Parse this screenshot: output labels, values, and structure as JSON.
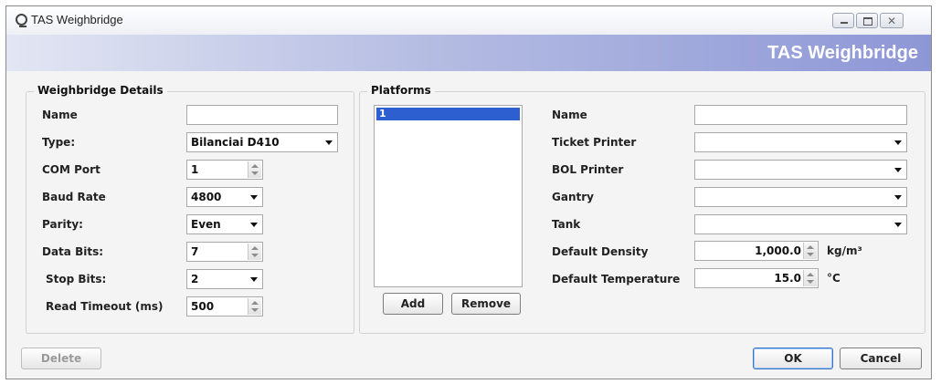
{
  "window": {
    "title": "TAS Weighbridge",
    "banner_title": "TAS Weighbridge"
  },
  "icons": {
    "app": "weighbridge-app-icon",
    "minimize": "minimize-icon",
    "maximize": "maximize-icon",
    "close": "close-icon"
  },
  "weighbridge_details": {
    "group_title": "Weighbridge Details",
    "name_label": "Name",
    "name_value": "",
    "type_label": "Type:",
    "type_value": "Bilanciai D410",
    "com_port_label": "COM Port",
    "com_port_value": "1",
    "baud_rate_label": "Baud Rate",
    "baud_rate_value": "4800",
    "parity_label": "Parity:",
    "parity_value": "Even",
    "data_bits_label": "Data Bits:",
    "data_bits_value": "7",
    "stop_bits_label": "Stop Bits:",
    "stop_bits_value": "2",
    "read_timeout_label": "Read Timeout (ms)",
    "read_timeout_value": "500"
  },
  "platforms": {
    "group_title": "Platforms",
    "items": [
      "1"
    ],
    "add_label": "Add",
    "remove_label": "Remove",
    "name_label": "Name",
    "name_value": "",
    "ticket_printer_label": "Ticket Printer",
    "ticket_printer_value": "",
    "bol_printer_label": "BOL Printer",
    "bol_printer_value": "",
    "gantry_label": "Gantry",
    "gantry_value": "",
    "tank_label": "Tank",
    "tank_value": "",
    "default_density_label": "Default Density",
    "default_density_value": "1,000.0",
    "density_unit": "kg/m³",
    "default_temperature_label": "Default Temperature",
    "default_temperature_value": "15.0",
    "temperature_unit": "°C"
  },
  "footer": {
    "delete_label": "Delete",
    "ok_label": "OK",
    "cancel_label": "Cancel"
  },
  "colors": {
    "banner_end": "#8e97d6",
    "selection": "#2e5fd0",
    "default_button_border": "#3a74c9"
  }
}
